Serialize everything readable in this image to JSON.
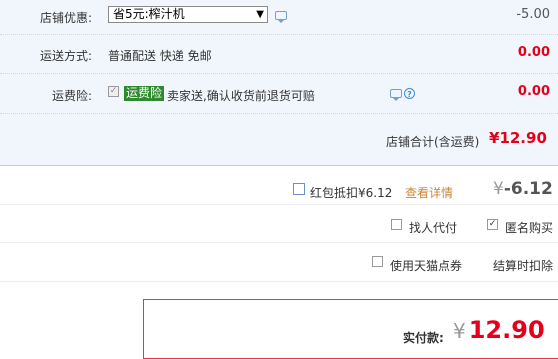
{
  "shop_discount": {
    "label": "店铺优惠:",
    "selected_option": "省5元:榨汁机",
    "amount": "-5.00"
  },
  "shipping": {
    "label": "运送方式:",
    "method": "普通配送 快递 免邮",
    "amount": "0.00"
  },
  "shipping_insurance": {
    "label": "运费险:",
    "tag": "运费险",
    "description": "卖家送,确认收货前退货可赔",
    "amount": "0.00"
  },
  "shop_total": {
    "label": "店铺合计(含运费)",
    "currency": "¥",
    "value": "12.90"
  },
  "red_packet": {
    "label": "红包抵扣",
    "currency": "¥",
    "value": "6.12",
    "link": "查看详情",
    "amount_currency": "¥",
    "amount": "-6.12"
  },
  "options": {
    "proxy_pay": "找人代付",
    "anonymous": "匿名购买"
  },
  "points": {
    "label": "使用天猫点券",
    "note": "结算时扣除"
  },
  "final": {
    "label": "实付款:",
    "currency": "¥",
    "value": "12.90"
  },
  "colors": {
    "accent_red": "#e4001b",
    "panel_blue": "#f1f6fc",
    "tag_green": "#2d8a2d"
  }
}
